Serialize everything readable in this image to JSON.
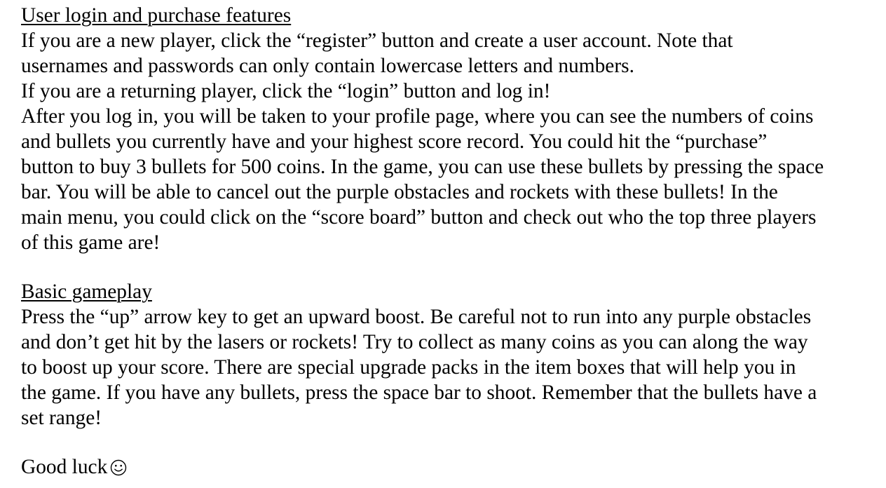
{
  "section1": {
    "heading": "User login and purchase features",
    "lines": [
      "If you are a new player, click the “register” button and create a user account. Note that",
      "usernames and passwords can only contain lowercase letters and numbers.",
      "If you are a returning player, click the “login” button and log in!",
      "After you log in, you will be taken to your profile page, where you can see the numbers of coins",
      "and bullets you currently have and your highest score record. You could hit the “purchase”",
      "button to buy 3 bullets for 500 coins. In the game, you can use these bullets by pressing the space",
      "bar. You will be able to cancel out the purple obstacles and rockets with these bullets! In the",
      "main menu, you could click on the “score board” button and check out who the top three players",
      "of this game are!"
    ]
  },
  "section2": {
    "heading": "Basic gameplay",
    "lines": [
      "Press the “up” arrow key to get an upward boost. Be careful not to run into any purple obstacles",
      "and don’t get hit by the lasers or rockets! Try to collect as many coins as you can along the way",
      "to boost up your score. There are special upgrade packs in the item boxes that will help you in",
      "the game. If you have any bullets, press the space bar to shoot. Remember that the bullets have a",
      "set range!"
    ]
  },
  "closing": {
    "text": "Good luck",
    "icon": "smiley-face-icon"
  }
}
